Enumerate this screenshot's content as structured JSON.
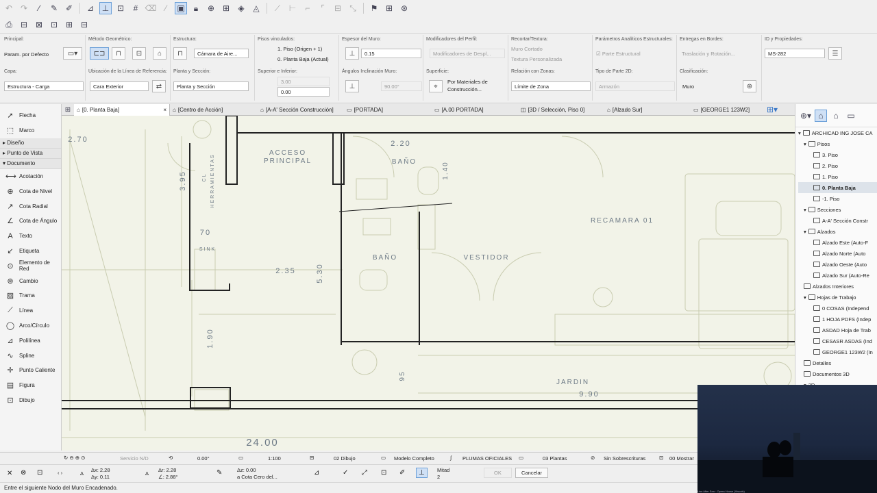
{
  "infobox": {
    "principal_label": "Principal:",
    "principal_value": "Param. por Defecto",
    "metodo_label": "Método Geométrico:",
    "estructura_label": "Estructura:",
    "estructura_value": "Cámara de Aire...",
    "pisos_label": "Pisos vinculados:",
    "piso_top": "1. Piso (Origen + 1)",
    "piso_bottom": "0. Planta Baja (Actual)",
    "espesor_label": "Espesor del Muro:",
    "espesor_value": "0.15",
    "modificadores_label": "Modificadores del Perfil:",
    "modificadores_value": "Modificadores de Despl...",
    "recortar_label": "Recortar/Textura:",
    "muro_cortado": "Muro Cortado",
    "textura_personalizada": "Textura Personalizada",
    "parametros_label": "Parámetros Analíticos Estructurales:",
    "parte_estructural": "Parte Estructural",
    "entregas_label": "Entregas en Bordes:",
    "entregas_value": "Traslación y Rotación...",
    "id_label": "ID y Propiedades:",
    "id_value": "MS-282",
    "capa_label": "Capa:",
    "capa_value": "Estructura - Carga",
    "ubicacion_label": "Ubicación de la Línea de Referencia:",
    "ubicacion_value": "Cara Exterior",
    "planta_label": "Planta y Sección:",
    "planta_value": "Planta y Sección",
    "superior_label": "Superior e Inferior:",
    "superior_top": "3.00",
    "superior_bottom": "0.00",
    "angulos_label": "Ángulos Inclinación Muro:",
    "angulo_value": "90.00°",
    "superficie_label": "Superficie:",
    "superficie_value_1": "Por Materiales de",
    "superficie_value_2": "Construcción...",
    "relacion_label": "Relación con Zonas:",
    "relacion_value": "Límite de Zona",
    "tipo_label": "Tipo de Parte 2D:",
    "tipo_value": "Armazón",
    "clasificacion_label": "Clasificación:",
    "clasificacion_value": "Muro"
  },
  "toolbox": {
    "flecha": "Flecha",
    "marco": "Marco",
    "diseno": "Diseño",
    "punto_vista": "Punto de Vista",
    "documento": "Documento",
    "acotacion": "Acotación",
    "cota_nivel": "Cota de Nivel",
    "cota_radial": "Cota Radial",
    "cota_angulo": "Cota de Ángulo",
    "texto": "Texto",
    "etiqueta": "Etiqueta",
    "elemento_red": "Elemento de Red",
    "cambio": "Cambio",
    "trama": "Trama",
    "linea": "Línea",
    "arco": "Arco/Círculo",
    "polilinea": "Polilínea",
    "spline": "Spline",
    "punto_caliente": "Punto Caliente",
    "figura": "Figura",
    "dibujo": "Dibujo"
  },
  "tabs": {
    "t0": "[0. Planta Baja]",
    "t1": "[Centro de Acción]",
    "t2": "[A-A' Sección Construcción]",
    "t3": "[PORTADA]",
    "t4": "[A.00 PORTADA]",
    "t5": "[3D / Selección, Piso 0]",
    "t6": "[Alzado Sur]",
    "t7": "[GEORGE1 123W2]"
  },
  "drawing": {
    "dim_270": "2.70",
    "dim_395": "3.95",
    "cl_label": "CL",
    "herramientas": "HERRAMIENTAS",
    "acceso": "ACCESO",
    "principal": "PRINCIPAL",
    "dim_220": "2.20",
    "bano_top": "BAÑO",
    "dim_140": "1.40",
    "dim_70": "70",
    "sink": "SINK",
    "dim_235": "2.35",
    "dim_530": "5.30",
    "bano_bottom": "BAÑO",
    "vestidor": "VESTIDOR",
    "recamara": "RECAMARA 01",
    "dim_190": "1.90",
    "dim_95": "95",
    "jardin": "JARDIN",
    "dim_990": "9.90",
    "dim_2400": "24.00"
  },
  "navigator": {
    "project": "ARCHICAD ING JOSE CA",
    "pisos": "Pisos",
    "piso3": "3. Piso",
    "piso2": "2. Piso",
    "piso1": "1. Piso",
    "piso0": "0. Planta Baja",
    "pisoneg": "-1. Piso",
    "secciones": "Secciones",
    "seccion_aa": "A-A' Sección Constr",
    "alzados": "Alzados",
    "alzado_este": "Alzado Este (Auto-F",
    "alzado_norte": "Alzado Norte (Auto",
    "alzado_oeste": "Alzado Oeste (Auto",
    "alzado_sur": "Alzado Sur (Auto-Re",
    "alzados_interiores": "Alzados Interiores",
    "hojas": "Hojas de Trabajo",
    "hoja0": "0 COSAS (Independ",
    "hoja1": "1 HOJA PDFS (Indep",
    "hoja2": "ASDAD Hoja de Trab",
    "hoja3": "CESASR ASDAS (Ind",
    "hoja4": "GEORGE1 123W2 (In",
    "detalles": "Detalles",
    "documentos3d": "Documentos 3D",
    "item3d": "3D"
  },
  "bottombar": {
    "servicio": "Servicio N/D",
    "angle": "0.00°",
    "scale": "1:100",
    "dibujo": "02 Dibujo",
    "modelo": "Modelo Completo",
    "plumas": "PLUMAS OFICIALES",
    "plantas": "03 Plantas",
    "sobrescrituras": "Sin Sobrescrituras",
    "mostrar": "00 Mostrar"
  },
  "coords": {
    "ax": "Δx: 2.28",
    "ay": "Δy: 0.11",
    "ar": "Δr: 2.28",
    "aa": "∠: 2.88°",
    "az": "Δz: 0.00",
    "cota_cero": "a Cota Cero del...",
    "mitad": "Mitad",
    "mitad_n": "2",
    "ok": "OK",
    "cancel": "Cancelar"
  },
  "status": {
    "message": "Entre el siguiente Nodo del Muro Encadenado."
  },
  "video": {
    "caption": "Lisa After Sea · Opera House (Visuals)"
  }
}
